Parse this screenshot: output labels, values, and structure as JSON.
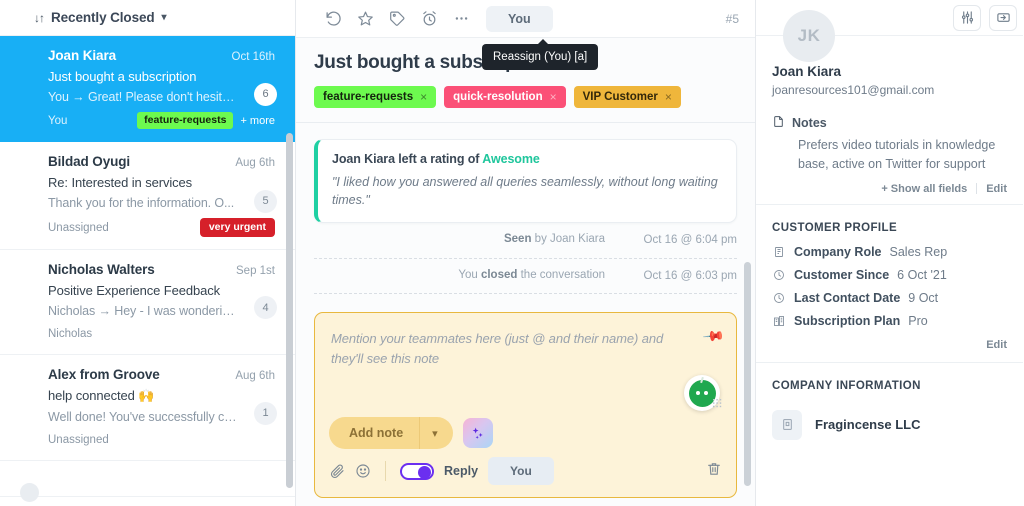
{
  "sidebar": {
    "sort_label": "Recently Closed",
    "sort_icon": "sort-icon",
    "conversations": [
      {
        "name": "Joan Kiara",
        "date": "Oct 16th",
        "subject": "Just bought a subscription",
        "preview": "You → Great! Please don't hesitate...",
        "assignee": "You",
        "count": "6",
        "tag": "feature-requests",
        "tag_color": "#6dfa4f",
        "more_label": "+ more",
        "selected": true
      },
      {
        "name": "Bildad Oyugi",
        "date": "Aug 6th",
        "subject": "Re: Interested in services",
        "preview": "Thank you for the information.  O...",
        "assignee": "Unassigned",
        "count": "5",
        "tag": "very urgent",
        "tag_color": "#d6202a",
        "more_label": "",
        "selected": false
      },
      {
        "name": "Nicholas Walters",
        "date": "Sep 1st",
        "subject": "Positive Experience Feedback",
        "preview": "Nicholas → Hey - I was wondering...",
        "assignee": "Nicholas",
        "count": "4",
        "tag": "",
        "tag_color": "",
        "more_label": "",
        "selected": false
      },
      {
        "name": "Alex from Groove",
        "date": "Aug 6th",
        "subject": "help connected 🙌",
        "preview": "Well done! You've successfully co...",
        "assignee": "Unassigned",
        "count": "1",
        "tag": "",
        "tag_color": "",
        "more_label": "",
        "selected": false
      }
    ]
  },
  "toolbar": {
    "icons": [
      "reopen-icon",
      "star-icon",
      "tag-icon",
      "snooze-icon",
      "more-options-icon"
    ],
    "assignee_label": "You",
    "conversation_number": "#5",
    "tooltip": "Reassign (You) [a]"
  },
  "conversation": {
    "title": "Just bought a subscription",
    "tags": [
      {
        "label": "feature-requests",
        "color": "#6dfa4f",
        "text_color": "#14240e",
        "close": "×"
      },
      {
        "label": "quick-resolution",
        "color": "#fb5077",
        "text_color": "#ffffff",
        "close": "×"
      },
      {
        "label": "VIP Customer",
        "color": "#efb63b",
        "text_color": "#33280a",
        "close": "×"
      }
    ],
    "rating": {
      "prefix": "Joan Kiara left a rating of",
      "value": "Awesome",
      "value_color": "#1fc69c",
      "quote": "\"I liked how you answered all queries seamlessly, without long waiting times.\""
    },
    "events": [
      {
        "text_pre": "Seen",
        "text_post": " by Joan Kiara",
        "bold_first": true,
        "time": "Oct 16 @ 6:04 pm"
      },
      {
        "text_pre": "You ",
        "text_bold": "closed",
        "text_post": " the conversation",
        "bold_first": false,
        "time": "Oct 16 @ 6:03 pm"
      }
    ]
  },
  "composer": {
    "placeholder": "Mention your teammates here (just @ and their name) and they'll see this note",
    "pin_icon": "pin-icon",
    "bot_icon": "bot-avatar-icon",
    "add_note_label": "Add note",
    "caret_icon": "chevron-down-icon",
    "ai_icon": "ai-sparkle-icon",
    "attach_icon": "paperclip-icon",
    "emoji_icon": "emoji-icon",
    "reply_label": "Reply",
    "assignee_chip": "You",
    "trash_icon": "trash-icon"
  },
  "right_panel": {
    "top_icons": [
      "sliders-icon",
      "collapse-panel-icon"
    ],
    "avatar_initials": "JK",
    "customer_name": "Joan Kiara",
    "customer_email": "joanresources101@gmail.com",
    "notes_label": "Notes",
    "notes_icon": "note-icon",
    "notes_body": "Prefers video tutorials in knowledge base, active on Twitter for support",
    "show_all_fields": "+ Show all fields",
    "edit_label": "Edit",
    "customer_profile_title": "CUSTOMER PROFILE",
    "profile_fields": [
      {
        "icon": "building-icon",
        "label": "Company Role",
        "value": "Sales Rep"
      },
      {
        "icon": "clock-icon",
        "label": "Customer Since",
        "value": "6 Oct '21"
      },
      {
        "icon": "clock-icon",
        "label": "Last Contact Date",
        "value": "9 Oct"
      },
      {
        "icon": "office-icon",
        "label": "Subscription Plan",
        "value": "Pro"
      }
    ],
    "profile_edit_label": "Edit",
    "company_info_title": "COMPANY INFORMATION",
    "company_name": "Fragincense LLC",
    "company_icon": "company-logo-icon"
  }
}
